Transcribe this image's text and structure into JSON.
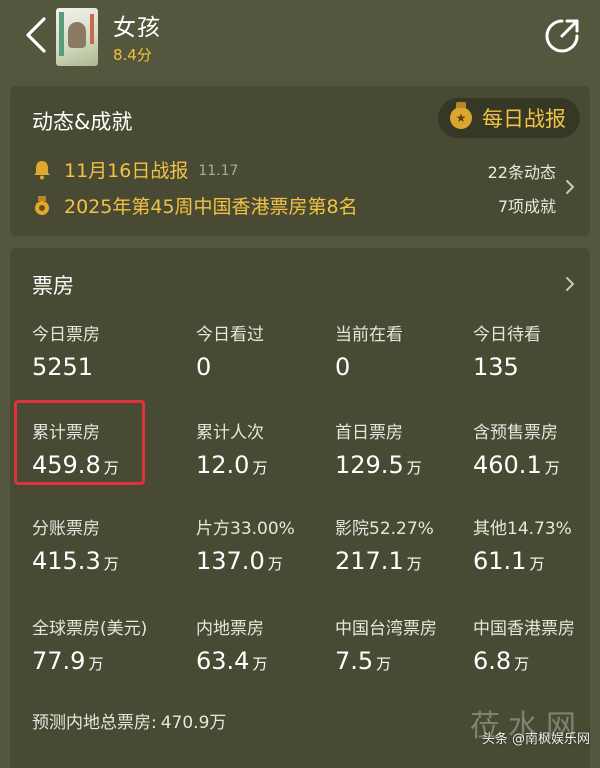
{
  "header": {
    "title": "女孩",
    "rating": "8.4分"
  },
  "achievements": {
    "title": "动态&成就",
    "daily_button": "每日战报",
    "events": [
      {
        "text": "11月16日战报",
        "date": "11.17"
      },
      {
        "text": "2025年第45周中国香港票房第8名"
      }
    ],
    "counts": [
      "22条动态",
      "7项成就"
    ]
  },
  "box_office": {
    "title": "票房",
    "rows": [
      [
        {
          "label": "今日票房",
          "value": "5251",
          "unit": ""
        },
        {
          "label": "今日看过",
          "value": "0",
          "unit": ""
        },
        {
          "label": "当前在看",
          "value": "0",
          "unit": ""
        },
        {
          "label": "今日待看",
          "value": "135",
          "unit": ""
        }
      ],
      [
        {
          "label": "累计票房",
          "value": "459.8",
          "unit": "万"
        },
        {
          "label": "累计人次",
          "value": "12.0",
          "unit": "万"
        },
        {
          "label": "首日票房",
          "value": "129.5",
          "unit": "万"
        },
        {
          "label": "含预售票房",
          "value": "460.1",
          "unit": "万"
        }
      ],
      [
        {
          "label": "分账票房",
          "value": "415.3",
          "unit": "万"
        },
        {
          "label": "片方33.00%",
          "value": "137.0",
          "unit": "万"
        },
        {
          "label": "影院52.27%",
          "value": "217.1",
          "unit": "万"
        },
        {
          "label": "其他14.73%",
          "value": "61.1",
          "unit": "万"
        }
      ],
      [
        {
          "label": "全球票房(美元)",
          "value": "77.9",
          "unit": "万"
        },
        {
          "label": "内地票房",
          "value": "63.4",
          "unit": "万"
        },
        {
          "label": "中国台湾票房",
          "value": "7.5",
          "unit": "万"
        },
        {
          "label": "中国香港票房",
          "value": "6.8",
          "unit": "万"
        }
      ]
    ],
    "forecast_label": "预测内地总票房:",
    "forecast_value": "470.9万"
  },
  "watermark": {
    "large": "莅水网",
    "small": "头条 @南枫娱乐网"
  },
  "colors": {
    "background": "#54573d",
    "card": "#464831",
    "accent_gold": "#f2c244",
    "highlight_red": "#e0323a"
  }
}
